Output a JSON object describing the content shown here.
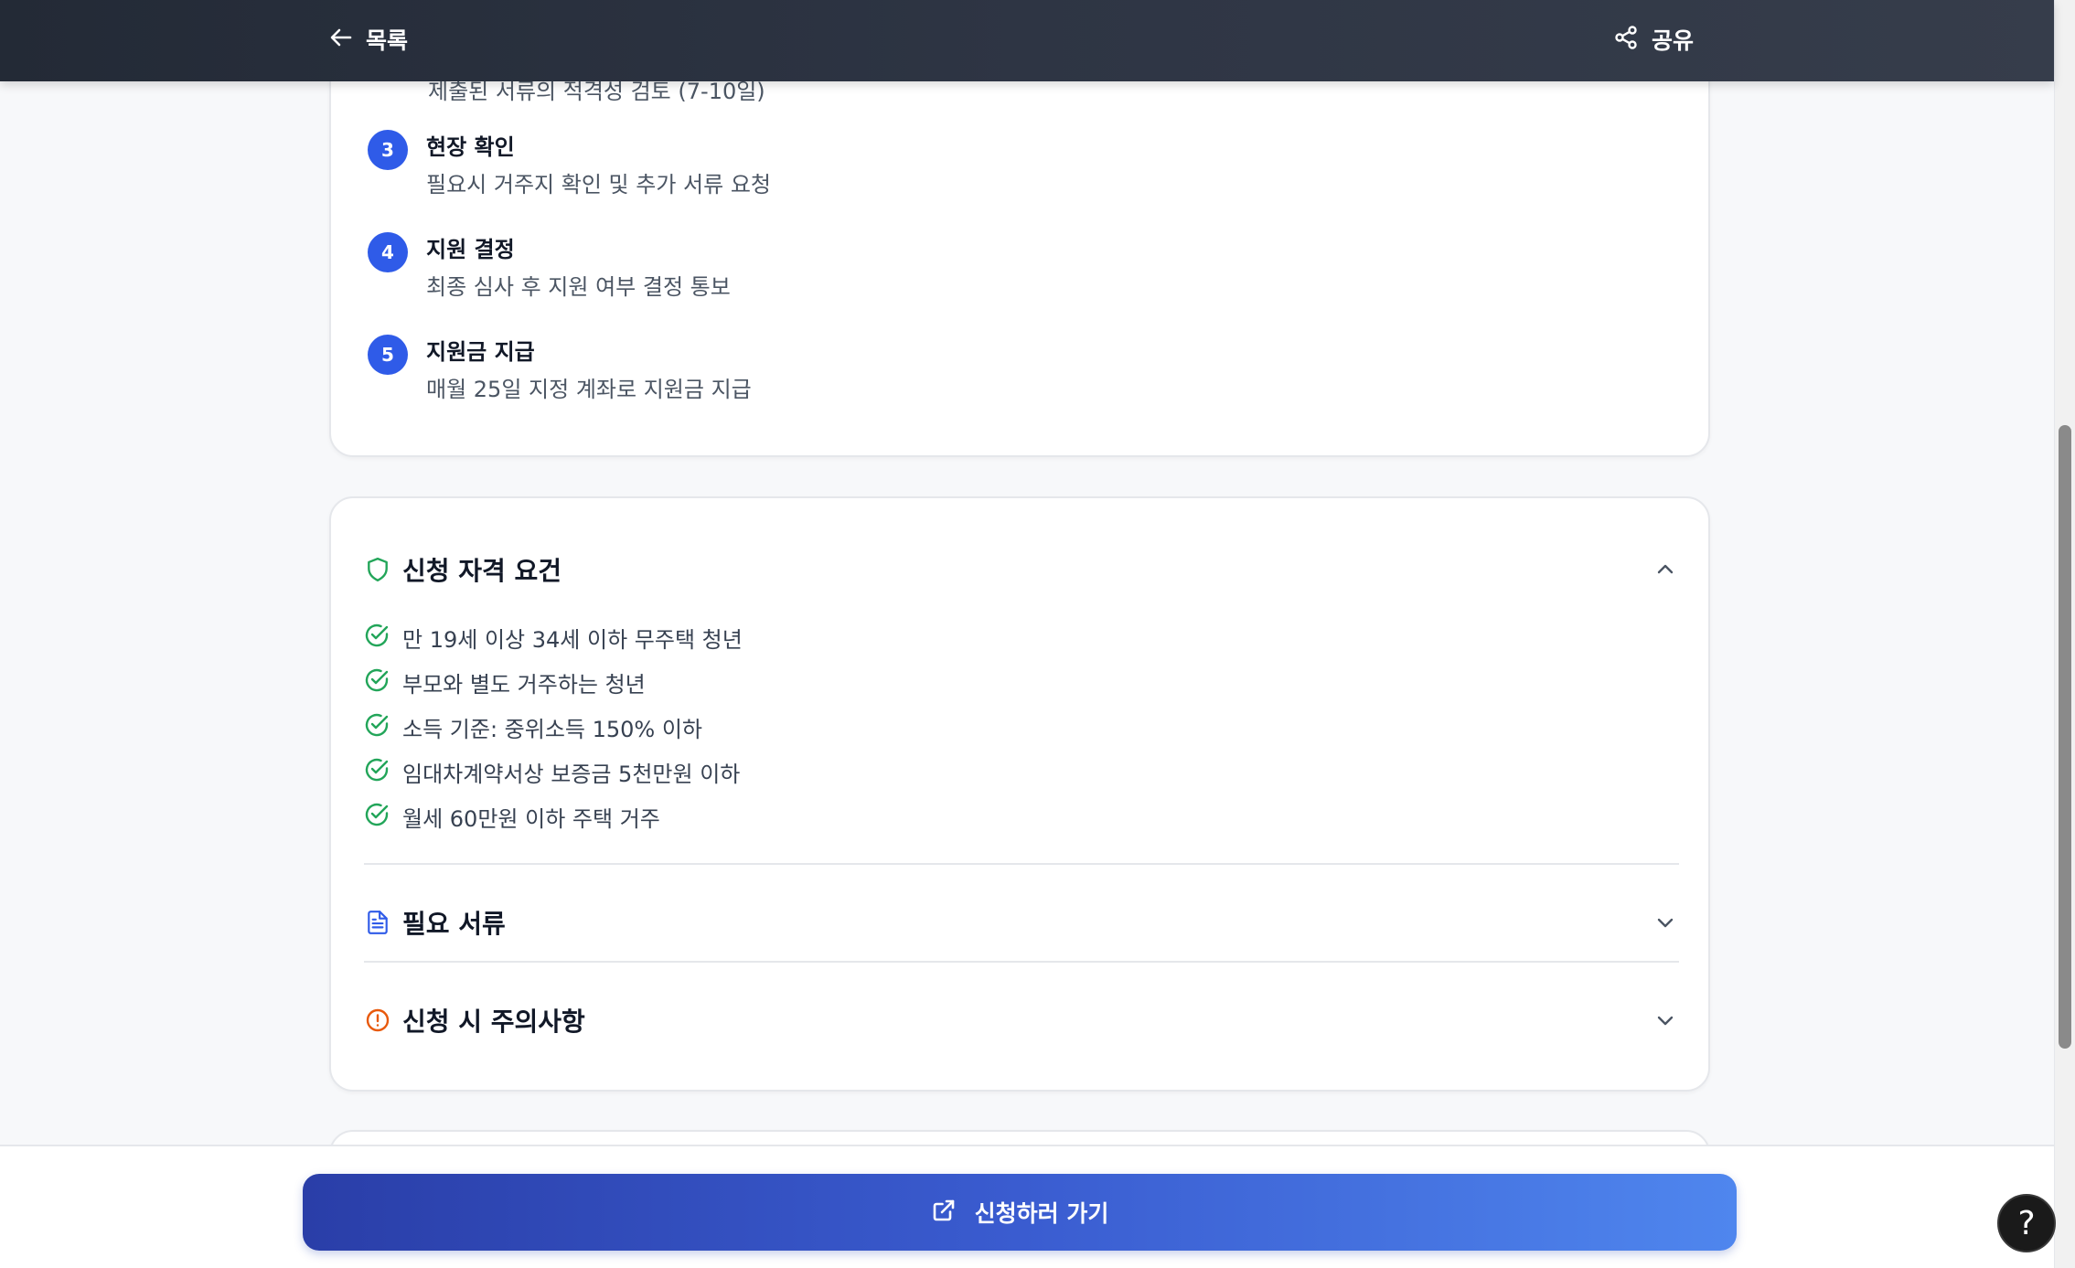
{
  "header": {
    "back_label": "목록",
    "share_label": "공유"
  },
  "steps_card": {
    "cut_off_text": "제출된 서류의 적격성 검토 (7-10일)",
    "steps": [
      {
        "num": "3",
        "title": "현장 확인",
        "desc": "필요시 거주지 확인 및 추가 서류 요청"
      },
      {
        "num": "4",
        "title": "지원 결정",
        "desc": "최종 심사 후 지원 여부 결정 통보"
      },
      {
        "num": "5",
        "title": "지원금 지급",
        "desc": "매월 25일 지정 계좌로 지원금 지급"
      }
    ]
  },
  "info_card": {
    "eligibility": {
      "title": "신청 자격 요건",
      "icon": "shield-icon",
      "expanded": true,
      "items": [
        "만 19세 이상 34세 이하 무주택 청년",
        "부모와 별도 거주하는 청년",
        "소득 기준: 중위소득 150% 이하",
        "임대차계약서상 보증금 5천만원 이하",
        "월세 60만원 이하 주택 거주"
      ]
    },
    "documents": {
      "title": "필요 서류",
      "icon": "document-icon",
      "expanded": false
    },
    "cautions": {
      "title": "신청 시 주의사항",
      "icon": "alert-circle-icon",
      "expanded": false
    }
  },
  "bottom": {
    "apply_label": "신청하러 가기"
  },
  "help": {
    "label": "?"
  },
  "colors": {
    "step_badge": "#2f5be8",
    "check_green": "#22a559",
    "doc_blue": "#2f5be8",
    "alert_orange": "#e8590c",
    "shield_green": "#22a559"
  }
}
